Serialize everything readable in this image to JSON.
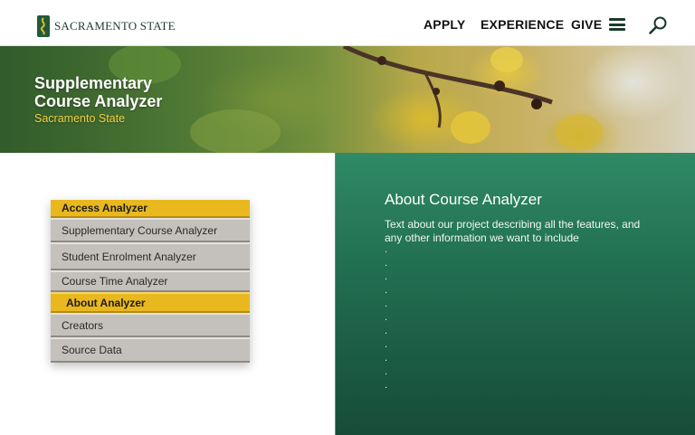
{
  "header": {
    "logo_text": "SACRAMENTO STATE",
    "nav": [
      {
        "label": "APPLY"
      },
      {
        "label": "EXPERIENCE"
      },
      {
        "label": "GIVE"
      }
    ],
    "icons": [
      "menu-icon",
      "search-icon"
    ]
  },
  "hero": {
    "title_line1": "Supplementary",
    "title_line2": "Course Analyzer",
    "subtitle": "Sacramento State"
  },
  "side_menu": {
    "access_heading": "Access Analyzer",
    "access_items": [
      {
        "label": "Supplementary Course Analyzer"
      },
      {
        "label": "Student Enrolment Analyzer"
      },
      {
        "label": "Course Time Analyzer"
      }
    ],
    "about_heading": "About Analyzer",
    "about_items": [
      {
        "label": "Creators"
      },
      {
        "label": "Source Data"
      }
    ]
  },
  "about_panel": {
    "title": "About Course Analyzer",
    "body": "Text about our project describing all the features, and any other information we want to include",
    "dots": [
      ".",
      ".",
      ".",
      ".",
      ".",
      ".",
      ".",
      ".",
      ".",
      ".",
      "."
    ]
  },
  "colors": {
    "accent_gold": "#e8b81e",
    "panel_green": "#226f52",
    "brand_dark_green": "#1f3b2d"
  }
}
